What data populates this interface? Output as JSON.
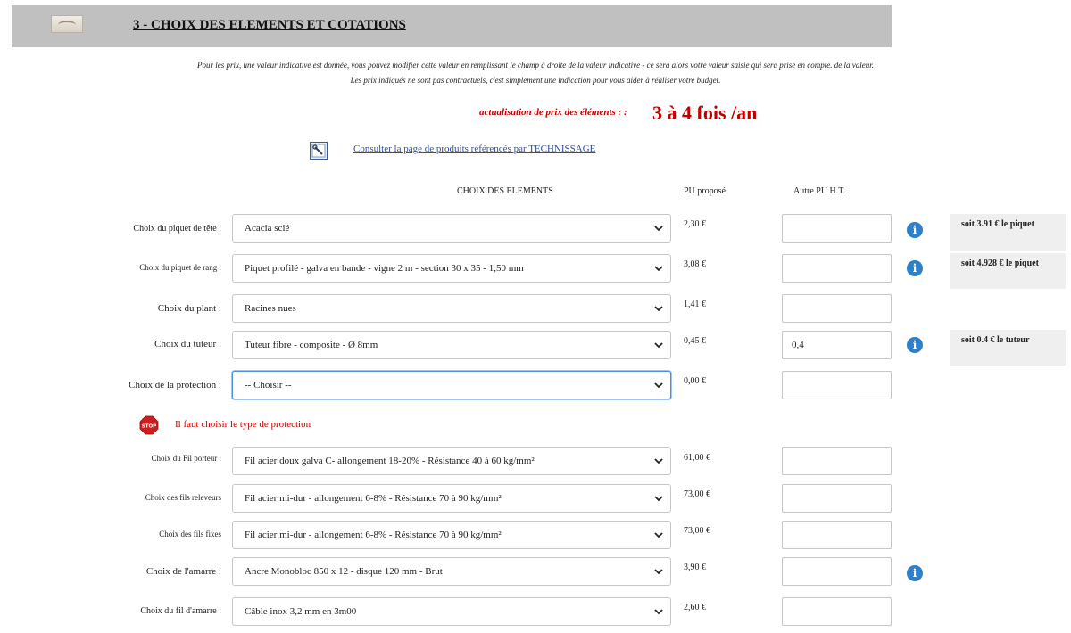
{
  "header": {
    "title": "3 - CHOIX DES ELEMENTS ET COTATIONS",
    "logo_icon": "logo-image"
  },
  "intro": {
    "line1": "Pour les prix, une valeur indicative est donnée, vous pouvez modifier cette valeur en remplissant le champ à droite de la valeur indicative - ce sera alors votre valeur saisie qui sera prise en compte. de la valeur.",
    "line2": "Les prix indiqués ne sont pas contractuels, c'est simplement une indication pour vous aider à réaliser votre budget."
  },
  "actualisation": {
    "label": "actualisation de prix des éléments : :",
    "value": "3 à 4 fois /an"
  },
  "consult": {
    "icon": "wrench-icon",
    "link_text": "Consulter la page de produits référencés par TECHNISSAGE"
  },
  "columns": {
    "choice": "CHOIX DES ELEMENTS",
    "pu": "PU proposé",
    "other_pu": "Autre PU H.T."
  },
  "rows": [
    {
      "label": "Choix du piquet de tête :",
      "selected": "Acacia scié",
      "price": "2,30 €",
      "input_value": "",
      "calc": "soit 3.91 € le piquet"
    },
    {
      "label": "Choix du piquet de rang :",
      "selected": "Piquet profilé - galva en bande - vigne 2 m - section 30 x 35 - 1,50 mm",
      "price": "3,08 €",
      "input_value": "",
      "calc": "soit 4.928 € le piquet"
    },
    {
      "label": "Choix du plant :",
      "selected": "Racines nues",
      "price": "1,41 €",
      "input_value": ""
    },
    {
      "label": "Choix du tuteur :",
      "selected": "Tuteur fibre - composite - Ø 8mm",
      "price": "0,45 €",
      "input_value": "0,4",
      "calc": "soit 0.4 € le tuteur"
    },
    {
      "label": "Choix de la protection :",
      "selected": "-- Choisir --",
      "price": "0,00 €",
      "input_value": ""
    },
    {
      "label": "Choix du Fil porteur :",
      "selected": "Fil acier doux galva C- allongement 18-20% - Résistance 40 à 60 kg/mm²",
      "price": "61,00 €",
      "input_value": ""
    },
    {
      "label": "Choix des fils releveurs",
      "selected": "Fil acier mi-dur - allongement 6-8% - Résistance 70 à 90 kg/mm²",
      "price": "73,00 €",
      "input_value": ""
    },
    {
      "label": "Choix des fils fixes",
      "selected": "Fil acier mi-dur - allongement 6-8% - Résistance 70 à 90 kg/mm²",
      "price": "73,00 €",
      "input_value": ""
    },
    {
      "label": "Choix de l'amarre :",
      "selected": "Ancre Monobloc 850 x 12 - disque 120 mm - Brut",
      "price": "3,90 €",
      "input_value": ""
    },
    {
      "label": "Choix du fil d'amarre :",
      "selected": "Câble inox 3,2 mm en 3m00",
      "price": "2,60 €",
      "input_value": ""
    }
  ],
  "warning": {
    "icon": "stop-icon",
    "text": "Il faut choisir le type de protection",
    "stop_text": "STOP"
  },
  "colors": {
    "header_bg": "#c0c0c0",
    "alert_red": "#c00000",
    "link_blue": "#2a4fb0",
    "info_blue": "#2f80c6"
  }
}
